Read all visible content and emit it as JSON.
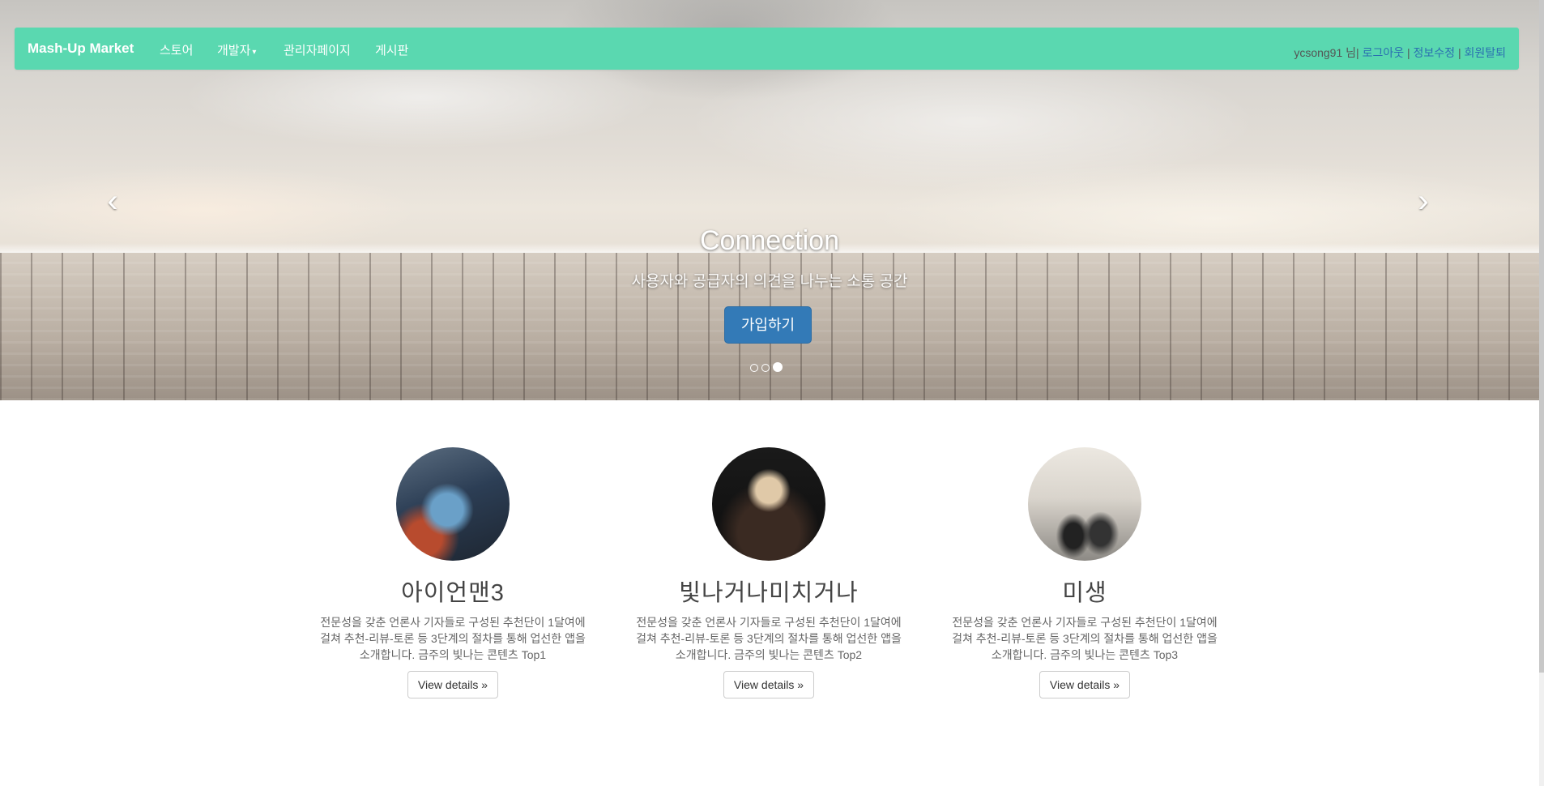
{
  "nav": {
    "brand": "Mash-Up Market",
    "items": [
      "스토어",
      "개발자",
      "관리자페이지",
      "게시판"
    ],
    "dropdown_caret": "▾",
    "user": {
      "greeting": "ycsong91 님",
      "logout": "로그아웃",
      "edit_info": "정보수정",
      "withdraw": "회원탈퇴",
      "separator": "|"
    }
  },
  "carousel": {
    "prev_icon": "chevron-left",
    "next_icon": "chevron-right",
    "prev_glyph": "‹",
    "next_glyph": "›",
    "title": "Connection",
    "subtitle": "사용자와 공급자의 의견을 나누는 소통 공간",
    "button": "가입하기",
    "active_slide": 3,
    "slide_count": 3
  },
  "cards": [
    {
      "title": "아이언맨3",
      "text": "전문성을 갖춘 언론사 기자들로 구성된 추천단이 1달여에 걸쳐 추천-리뷰-토론 등 3단계의 절차를 통해 업선한 앱을 소개합니다. 금주의 빛나는 콘텐츠 Top1",
      "button": "View details »",
      "thumb_colors": [
        "#2c3e55",
        "#b84b2e",
        "#6aa0c8"
      ]
    },
    {
      "title": "빛나거나미치거나",
      "text": "전문성을 갖춘 언론사 기자들로 구성된 추천단이 1달여에 걸쳐 추천-리뷰-토론 등 3단계의 절차를 통해 업선한 앱을 소개합니다. 금주의 빛나는 콘텐츠 Top2",
      "button": "View details »",
      "thumb_colors": [
        "#0d0d0d",
        "#3a2a22",
        "#e0c9a8"
      ]
    },
    {
      "title": "미생",
      "text": "전문성을 갖춘 언론사 기자들로 구성된 추천단이 1달여에 걸쳐 추천-리뷰-토론 등 3단계의 절차를 통해 업선한 앱을 소개합니다. 금주의 빛나는 콘텐츠 Top3",
      "button": "View details »",
      "thumb_colors": [
        "#d9d4cc",
        "#8d8a85",
        "#222222"
      ]
    }
  ],
  "colors": {
    "navbar": "#5ad8b0",
    "primary_button": "#337ab7",
    "link": "#2a6fb0"
  }
}
